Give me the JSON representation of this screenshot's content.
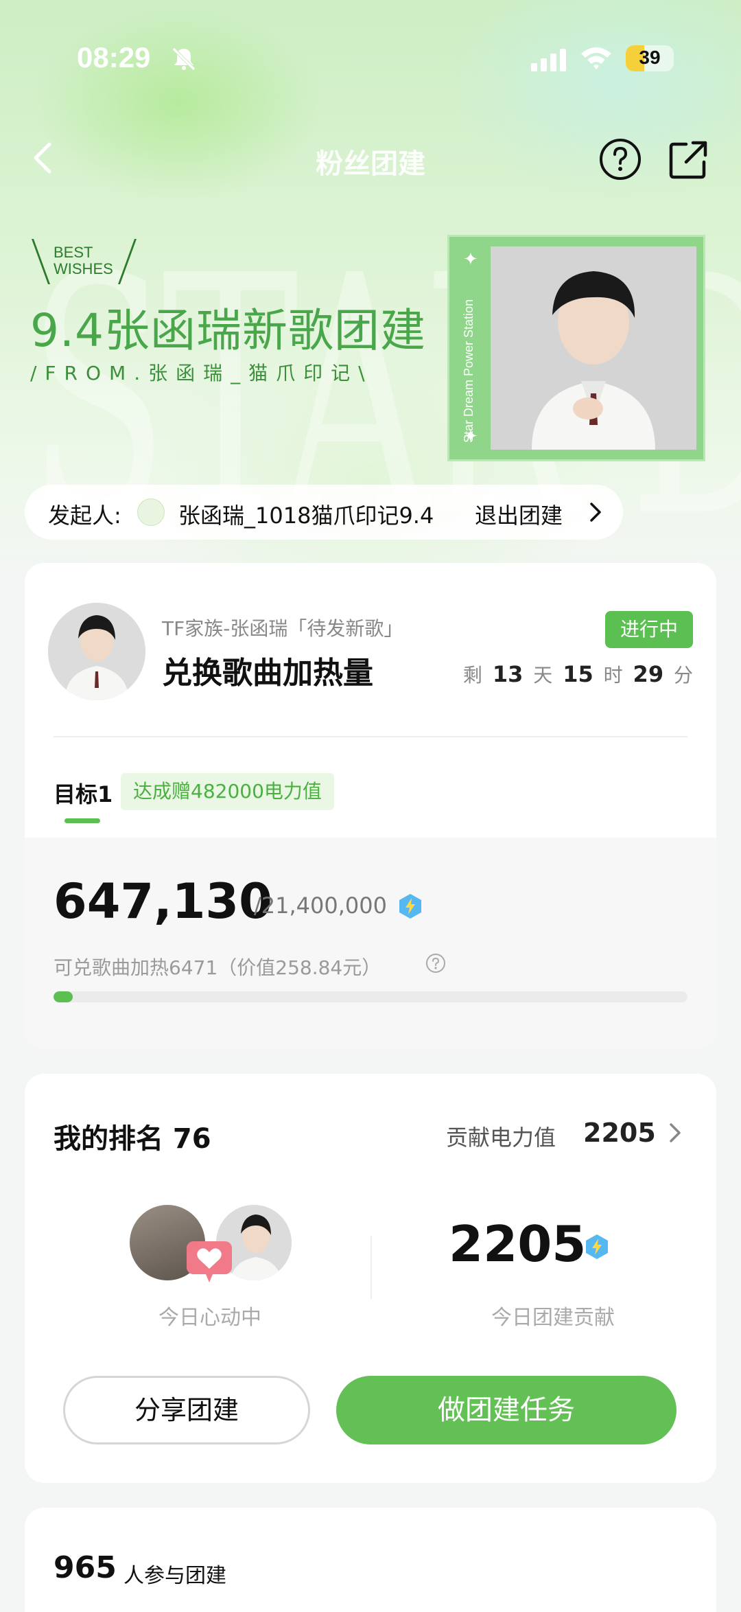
{
  "status_bar": {
    "time": "08:29",
    "battery": "39",
    "battery_level": 0.39
  },
  "nav": {
    "title": "粉丝团建"
  },
  "hero": {
    "watermark": "STAR DREAM",
    "best_wishes_line1": "BEST",
    "best_wishes_line2": "WISHES",
    "event_title": "9.4张函瑞新歌团建",
    "event_from": "/FROM.张函瑞_猫爪印记\\",
    "photo_side_text": "Star Dream Power Station"
  },
  "initiator": {
    "label": "发起人:",
    "name": "张函瑞_1018猫爪印记9.4",
    "exit_label": "退出团建"
  },
  "task": {
    "subtitle": "TF家族-张函瑞「待发新歌」",
    "title": "兑换歌曲加热量",
    "status": "进行中",
    "countdown": {
      "prefix": "剩",
      "days": "13",
      "days_unit": "天",
      "hours": "15",
      "hours_unit": "时",
      "minutes": "29",
      "minutes_unit": "分"
    },
    "goal_tab": "目标1",
    "goal_reward": "达成赠482000电力值",
    "progress_current": "647,130",
    "progress_total": "/21,400,000",
    "progress_sub": "可兑歌曲加热6471（价值258.84元）",
    "progress_fraction": 0.03
  },
  "rank": {
    "title": "我的排名 76",
    "contrib_label": "贡献电力值",
    "contrib_value": "2205",
    "duo_label": "今日心动中",
    "today_value": "2205",
    "today_label": "今日团建贡献",
    "share_button": "分享团建",
    "task_button": "做团建任务"
  },
  "participants": {
    "count": "965",
    "label": "人参与团建"
  },
  "colors": {
    "accent": "#5cbf52",
    "progress_track": "#ebebeb",
    "heart": "#f07a88"
  }
}
